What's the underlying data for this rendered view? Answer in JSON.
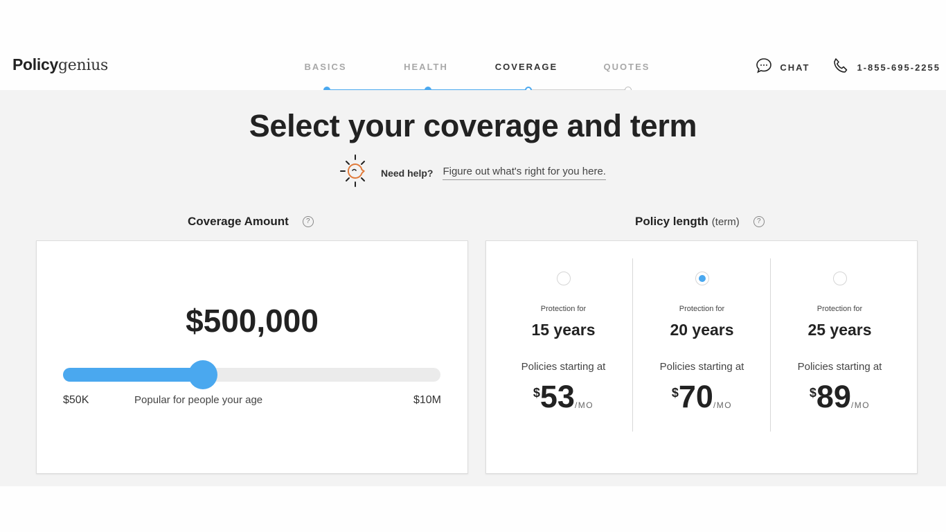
{
  "brand": {
    "bold": "Policy",
    "light": "genius"
  },
  "steps": [
    {
      "label": "BASICS",
      "state": "done"
    },
    {
      "label": "HEALTH",
      "state": "done"
    },
    {
      "label": "COVERAGE",
      "state": "current"
    },
    {
      "label": "QUOTES",
      "state": "todo"
    }
  ],
  "contact": {
    "chat_label": "CHAT",
    "phone": "1-855-695-2255"
  },
  "page": {
    "title": "Select your coverage and term",
    "help_label": "Need help?",
    "help_link": "Figure out what's right for you here."
  },
  "coverage": {
    "label": "Coverage Amount",
    "help_icon": "?",
    "amount": "$500,000",
    "slider_fraction": 0.37,
    "min_label": "$50K",
    "max_label": "$10M",
    "hint": "Popular for people your age"
  },
  "policy": {
    "label": "Policy length",
    "label_sub": "(term)",
    "help_icon": "?",
    "options": [
      {
        "prefix": "Protection for",
        "years": "15 years",
        "starting": "Policies starting at",
        "currency": "$",
        "price": "53",
        "per": "/MO",
        "selected": false
      },
      {
        "prefix": "Protection for",
        "years": "20 years",
        "starting": "Policies starting at",
        "currency": "$",
        "price": "70",
        "per": "/MO",
        "selected": true
      },
      {
        "prefix": "Protection for",
        "years": "25 years",
        "starting": "Policies starting at",
        "currency": "$",
        "price": "89",
        "per": "/MO",
        "selected": false
      }
    ]
  },
  "colors": {
    "accent": "#4aa8ef",
    "sun": "#e07a3a",
    "text": "#222222",
    "muted": "#a8a8a8"
  }
}
